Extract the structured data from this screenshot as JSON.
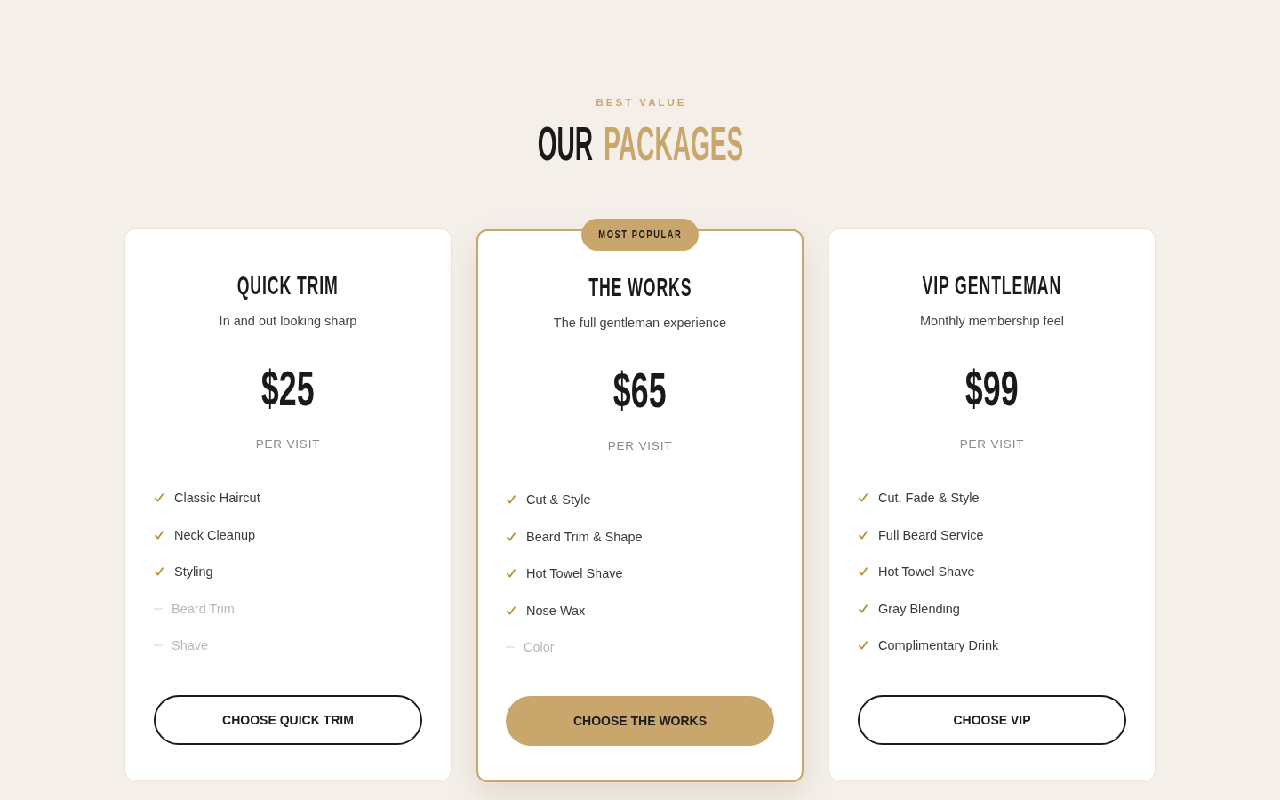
{
  "section": {
    "eyebrow": "BEST VALUE",
    "title_parts": [
      {
        "text": "OUR",
        "accent": false
      },
      {
        "text": "PACKAGES",
        "accent": true
      }
    ]
  },
  "packages": [
    {
      "name": "QUICK TRIM",
      "tagline": "In and out looking sharp",
      "price": "$25",
      "period": "PER VISIT",
      "featured": false,
      "features": [
        {
          "text": "Classic Haircut",
          "included": true
        },
        {
          "text": "Neck Cleanup",
          "included": true
        },
        {
          "text": "Styling",
          "included": true
        },
        {
          "text": "Beard Trim",
          "included": false
        },
        {
          "text": "Shave",
          "included": false
        }
      ],
      "button": "CHOOSE QUICK TRIM"
    },
    {
      "name": "THE WORKS",
      "tagline": "The full gentleman experience",
      "price": "$65",
      "period": "PER VISIT",
      "featured": true,
      "badge": "MOST POPULAR",
      "features": [
        {
          "text": "Cut & Style",
          "included": true
        },
        {
          "text": "Beard Trim & Shape",
          "included": true
        },
        {
          "text": "Hot Towel Shave",
          "included": true
        },
        {
          "text": "Nose Wax",
          "included": true
        },
        {
          "text": "Color",
          "included": false
        }
      ],
      "button": "CHOOSE THE WORKS"
    },
    {
      "name": "VIP GENTLEMAN",
      "tagline": "Monthly membership feel",
      "price": "$99",
      "period": "PER VISIT",
      "featured": false,
      "features": [
        {
          "text": "Cut, Fade & Style",
          "included": true
        },
        {
          "text": "Full Beard Service",
          "included": true
        },
        {
          "text": "Hot Towel Shave",
          "included": true
        },
        {
          "text": "Gray Blending",
          "included": true
        },
        {
          "text": "Complimentary Drink",
          "included": true
        }
      ],
      "button": "CHOOSE VIP"
    }
  ]
}
